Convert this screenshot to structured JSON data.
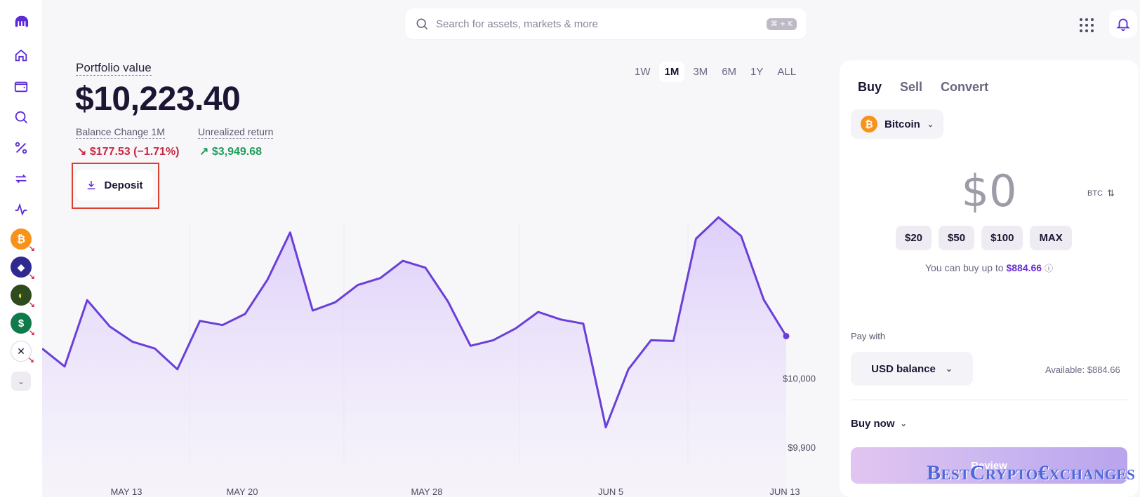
{
  "search": {
    "placeholder": "Search for assets, markets & more",
    "shortcut": "⌘ + K"
  },
  "sidebar": {
    "nav_icons": [
      "home-icon",
      "wallet-icon",
      "search-icon",
      "percent-icon",
      "transfer-icon",
      "activity-icon"
    ],
    "assets": [
      "bitcoin",
      "ethereum",
      "green-asset",
      "dollar-asset",
      "x-asset"
    ]
  },
  "portfolio": {
    "label": "Portfolio value",
    "value": "$10,223.40",
    "balance_change_label": "Balance Change 1M",
    "balance_change_value": "$177.53 (−1.71%)",
    "unrealized_label": "Unrealized return",
    "unrealized_value": "$3,949.68",
    "deposit_label": "Deposit"
  },
  "ranges": [
    "1W",
    "1M",
    "3M",
    "6M",
    "1Y",
    "ALL"
  ],
  "active_range": "1M",
  "chart_data": {
    "type": "area",
    "x_labels": [
      "MAY 13",
      "MAY 20",
      "MAY 28",
      "JUN 5",
      "JUN 13"
    ],
    "y_labels": [
      "$10,000",
      "$9,900"
    ],
    "values": [
      10050,
      10024,
      10120,
      10082,
      10060,
      10050,
      10020,
      10090,
      10084,
      10100,
      10150,
      10218,
      10105,
      10117,
      10142,
      10152,
      10177,
      10167,
      10118,
      10054,
      10062,
      10079,
      10103,
      10092,
      10086,
      9936,
      10020,
      10062,
      10061,
      10209,
      10240,
      10213,
      10121,
      10068
    ],
    "line_color": "#6a3fd9",
    "fill_color": "#e5d9fb"
  },
  "trade": {
    "tabs": [
      "Buy",
      "Sell",
      "Convert"
    ],
    "asset": "Bitcoin",
    "amount": "$0",
    "unit_toggle": "BTC",
    "presets": [
      "$20",
      "$50",
      "$100",
      "MAX"
    ],
    "buy_up_prefix": "You can buy up to",
    "buy_up_amount": "$884.66",
    "pay_with_label": "Pay with",
    "pay_with_value": "USD balance",
    "available": "Available: $884.66",
    "buy_now_label": "Buy now",
    "review_label": "Review"
  },
  "watermark": "BestCrypto€xchanges"
}
